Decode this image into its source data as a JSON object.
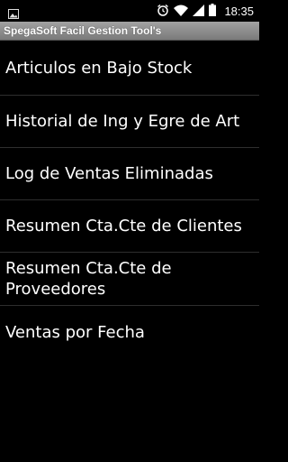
{
  "status_bar": {
    "time": "18:35",
    "icons": [
      "gallery-icon",
      "alarm-clock-icon",
      "wifi-icon",
      "signal-icon",
      "battery-icon"
    ]
  },
  "app": {
    "title": "SpegaSoft Facil Gestion Tool's"
  },
  "menu": {
    "items": [
      {
        "label": "Articulos en Bajo Stock"
      },
      {
        "label": "Historial de Ing y Egre de Art"
      },
      {
        "label": "Log de Ventas Eliminadas"
      },
      {
        "label": "Resumen Cta.Cte de Clientes"
      },
      {
        "label": "Resumen Cta.Cte de Proveedores"
      },
      {
        "label": "Ventas por Fecha"
      }
    ]
  }
}
